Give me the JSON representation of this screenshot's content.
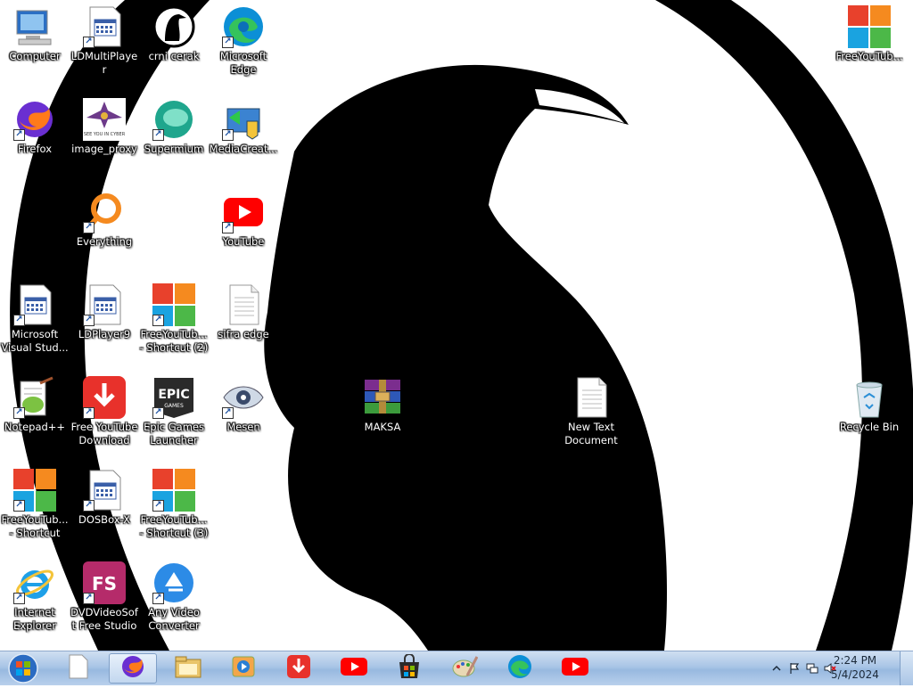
{
  "desktop": {
    "icons": [
      {
        "id": "computer",
        "label": "Computer"
      },
      {
        "id": "ldmultiplayer",
        "label": "LDMultiPlayer"
      },
      {
        "id": "crni-cerak",
        "label": "crni cerak"
      },
      {
        "id": "microsoft-edge",
        "label": "Microsoft Edge"
      },
      {
        "id": "firefox",
        "label": "Firefox"
      },
      {
        "id": "image-proxy",
        "label": "image_proxy"
      },
      {
        "id": "supermium",
        "label": "Supermium"
      },
      {
        "id": "mediacreation",
        "label": "MediaCreat..."
      },
      {
        "id": "everything",
        "label": "Everything"
      },
      {
        "id": "youtube",
        "label": "YouTube"
      },
      {
        "id": "visual-studio",
        "label": "Microsoft Visual Stud..."
      },
      {
        "id": "ldplayer9",
        "label": "LDPlayer9"
      },
      {
        "id": "fyt-shortcut-2",
        "label": "FreeYouTub... - Shortcut (2)"
      },
      {
        "id": "sifra-edge",
        "label": "sifra edge"
      },
      {
        "id": "notepadpp",
        "label": "Notepad++"
      },
      {
        "id": "free-youtube-download",
        "label": "Free YouTube Download"
      },
      {
        "id": "epic-games",
        "label": "Epic Games Launcher"
      },
      {
        "id": "mesen",
        "label": "Mesen"
      },
      {
        "id": "maksa",
        "label": "MAKSA"
      },
      {
        "id": "new-text-document",
        "label": "New Text Document"
      },
      {
        "id": "recycle-bin",
        "label": "Recycle Bin"
      },
      {
        "id": "fyt-shortcut",
        "label": "FreeYouTub... - Shortcut"
      },
      {
        "id": "dosbox-x",
        "label": "DOSBox-X"
      },
      {
        "id": "fyt-shortcut-3",
        "label": "FreeYouTub... - Shortcut (3)"
      },
      {
        "id": "internet-explorer",
        "label": "Internet Explorer"
      },
      {
        "id": "dvdvideosoft",
        "label": "DVDVideoSoft Free Studio"
      },
      {
        "id": "any-video-converter",
        "label": "Any Video Converter"
      },
      {
        "id": "freeyoutub-top",
        "label": "FreeYouTub..."
      }
    ]
  },
  "epic_logo_text": "EPIC",
  "epic_logo_sub": "GAMES",
  "fs_logo_text": "FS",
  "image_proxy_text": "SEE YOU IN CYBER",
  "taskbar": {
    "clock_time": "2:24 PM",
    "clock_date": "5/4/2024",
    "pinned": [
      "blank-document-icon",
      "firefox-icon",
      "file-explorer-icon",
      "media-player-icon",
      "free-youtube-download-icon",
      "youtube-icon",
      "store-icon",
      "paint-icon",
      "edge-icon",
      "youtube-icon"
    ]
  },
  "colors": {
    "taskbar_top": "#cfdff1",
    "taskbar_bottom": "#98b9e0",
    "wallpaper_bird": "#000000",
    "wallpaper_bg": "#ffffff"
  }
}
